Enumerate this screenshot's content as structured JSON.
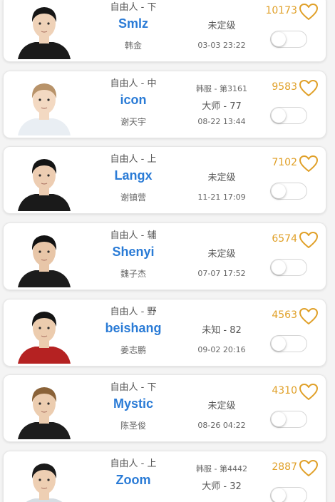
{
  "theme": {
    "name_color": "#2a7bd6",
    "score_color": "#e0a028",
    "heart_icon": "heart-outline-icon"
  },
  "players": [
    {
      "role": "自由人 - 下",
      "name": "Smlz",
      "realname": "韩金",
      "server": "",
      "rank": "未定级",
      "time": "03-03 23:22",
      "score": "10173",
      "jersey": "#1a1a1a",
      "hair": "#161616",
      "skin": "#efd2b8",
      "favorited": false
    },
    {
      "role": "自由人 - 中",
      "name": "icon",
      "realname": "谢天宇",
      "server": "韩服 - 第3161",
      "rank": "大师 - 77",
      "time": "08-22 13:44",
      "score": "9583",
      "jersey": "#e9eef3",
      "hair": "#b8936a",
      "skin": "#f3d9c2",
      "favorited": false
    },
    {
      "role": "自由人 - 上",
      "name": "Langx",
      "realname": "谢镇营",
      "server": "",
      "rank": "未定级",
      "time": "11-21 17:09",
      "score": "7102",
      "jersey": "#1a1a1a",
      "hair": "#151515",
      "skin": "#edcdb2",
      "favorited": false
    },
    {
      "role": "自由人 - 辅",
      "name": "Shenyi",
      "realname": "魏子杰",
      "server": "",
      "rank": "未定级",
      "time": "07-07 17:52",
      "score": "6574",
      "jersey": "#1c1c1c",
      "hair": "#121212",
      "skin": "#e8c6a8",
      "favorited": false
    },
    {
      "role": "自由人 - 野",
      "name": "beishang",
      "realname": "姜志鹏",
      "server": "",
      "rank": "未知 - 82",
      "time": "09-02 20:16",
      "score": "4563",
      "jersey": "#b52222",
      "hair": "#141414",
      "skin": "#ecccae",
      "favorited": false
    },
    {
      "role": "自由人 - 下",
      "name": "Mystic",
      "realname": "陈圣俊",
      "server": "",
      "rank": "未定级",
      "time": "08-26 04:22",
      "score": "4310",
      "jersey": "#1d1d1d",
      "hair": "#8a6238",
      "skin": "#eccdb0",
      "favorited": false
    },
    {
      "role": "自由人 - 上",
      "name": "Zoom",
      "realname": "",
      "server": "韩服 - 第4442",
      "rank": "大师 - 32",
      "time": "",
      "score": "2887",
      "jersey": "#d6dde3",
      "hair": "#1a1a1a",
      "skin": "#eecfb3",
      "favorited": false
    }
  ]
}
